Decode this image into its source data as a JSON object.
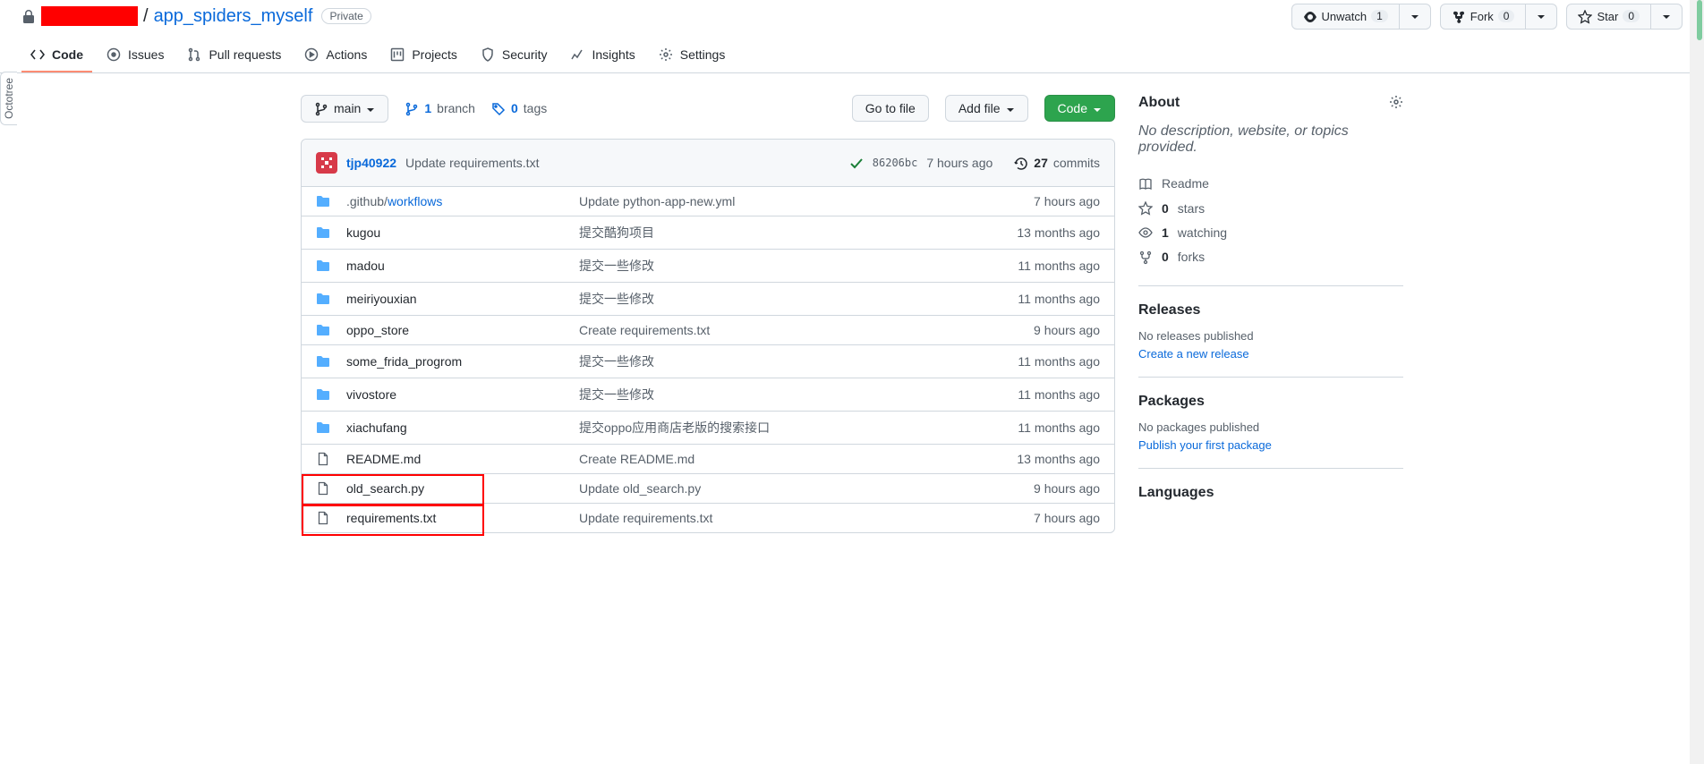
{
  "header": {
    "repo_name": "app_spiders_myself",
    "visibility": "Private",
    "watch_label": "Unwatch",
    "watch_count": "1",
    "fork_label": "Fork",
    "fork_count": "0",
    "star_label": "Star",
    "star_count": "0"
  },
  "tabs": {
    "code": "Code",
    "issues": "Issues",
    "pulls": "Pull requests",
    "actions": "Actions",
    "projects": "Projects",
    "security": "Security",
    "insights": "Insights",
    "settings": "Settings"
  },
  "toolbar": {
    "branch_selector": "main",
    "branch_count": "1",
    "branch_label": "branch",
    "tag_count": "0",
    "tag_label": "tags",
    "go_to_file": "Go to file",
    "add_file": "Add file",
    "code_btn": "Code"
  },
  "latest_commit": {
    "author": "tjp40922",
    "message": "Update requirements.txt",
    "sha": "86206bc",
    "time": "7 hours ago",
    "commit_count": "27",
    "commit_label": "commits"
  },
  "files": [
    {
      "type": "dir",
      "name": ".github/",
      "subpath": "workflows",
      "msg": "Update python-app-new.yml",
      "time": "7 hours ago"
    },
    {
      "type": "dir",
      "name": "kugou",
      "msg": "提交酷狗项目",
      "time": "13 months ago"
    },
    {
      "type": "dir",
      "name": "madou",
      "msg": "提交一些修改",
      "time": "11 months ago"
    },
    {
      "type": "dir",
      "name": "meiriyouxian",
      "msg": "提交一些修改",
      "time": "11 months ago"
    },
    {
      "type": "dir",
      "name": "oppo_store",
      "msg": "Create requirements.txt",
      "time": "9 hours ago"
    },
    {
      "type": "dir",
      "name": "some_frida_progrom",
      "msg": "提交一些修改",
      "time": "11 months ago"
    },
    {
      "type": "dir",
      "name": "vivostore",
      "msg": "提交一些修改",
      "time": "11 months ago"
    },
    {
      "type": "dir",
      "name": "xiachufang",
      "msg": "提交oppo应用商店老版的搜索接口",
      "time": "11 months ago"
    },
    {
      "type": "file",
      "name": "README.md",
      "msg": "Create README.md",
      "time": "13 months ago"
    },
    {
      "type": "file",
      "name": "old_search.py",
      "msg": "Update old_search.py",
      "time": "9 hours ago",
      "highlight": true
    },
    {
      "type": "file",
      "name": "requirements.txt",
      "msg": "Update requirements.txt",
      "time": "7 hours ago",
      "highlight": true
    }
  ],
  "about": {
    "title": "About",
    "desc": "No description, website, or topics provided.",
    "readme": "Readme",
    "stars_count": "0",
    "stars_label": "stars",
    "watching_count": "1",
    "watching_label": "watching",
    "forks_count": "0",
    "forks_label": "forks"
  },
  "releases": {
    "title": "Releases",
    "note": "No releases published",
    "action": "Create a new release"
  },
  "packages": {
    "title": "Packages",
    "note": "No packages published",
    "action": "Publish your first package"
  },
  "languages": {
    "title": "Languages"
  },
  "octotree": "Octotree"
}
